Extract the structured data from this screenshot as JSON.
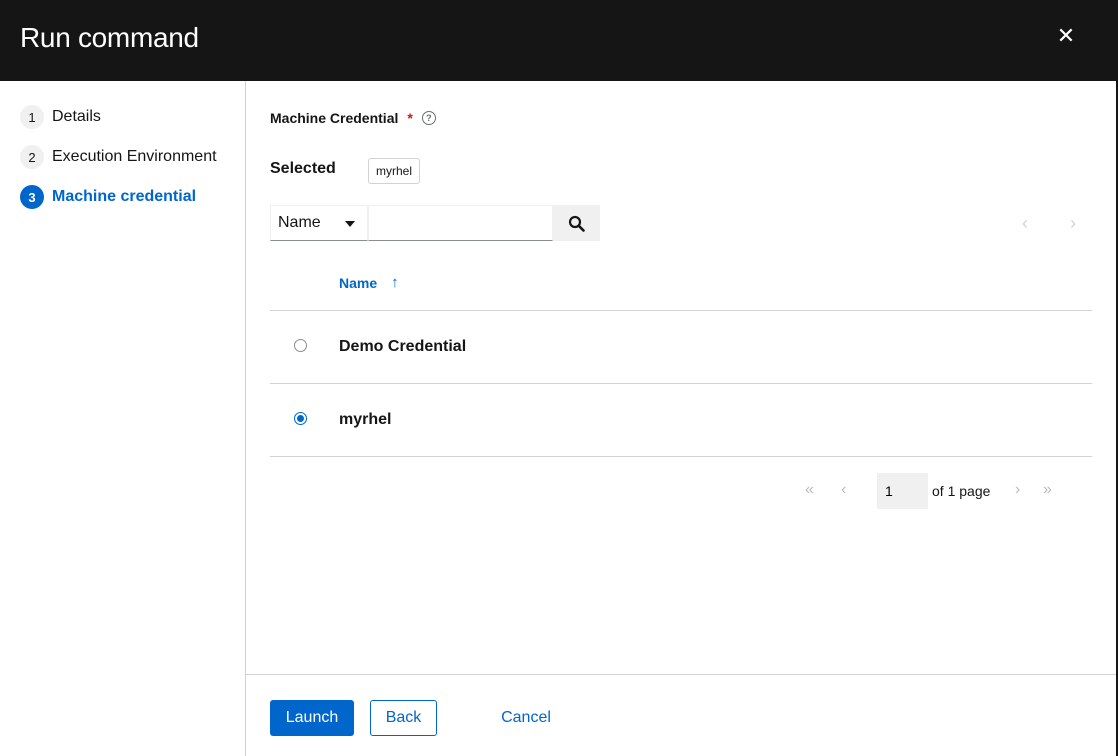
{
  "modal": {
    "title": "Run command",
    "close_icon": "close-icon"
  },
  "wizard": {
    "steps": [
      {
        "number": "1",
        "label": "Details",
        "active": false
      },
      {
        "number": "2",
        "label": "Execution Environment",
        "active": false
      },
      {
        "number": "3",
        "label": "Machine credential",
        "active": true
      }
    ]
  },
  "form": {
    "field_label": "Machine Credential",
    "required_marker": "*",
    "help_icon": "question-circle-icon",
    "selected_label": "Selected",
    "selected_chip": "myrhel"
  },
  "toolbar": {
    "filter_select_value": "Name",
    "search_value": "",
    "search_icon": "search-icon",
    "prev_icon": "chevron-left-icon",
    "next_icon": "chevron-right-icon"
  },
  "table": {
    "column_header": "Name",
    "sort_icon": "sort-ascending-icon",
    "rows": [
      {
        "name": "Demo Credential",
        "selected": false
      },
      {
        "name": "myrhel",
        "selected": true
      }
    ]
  },
  "pagination": {
    "current_page": "1",
    "of_pages_text": "of 1 page",
    "first_icon": "angle-double-left-icon",
    "prev_icon": "angle-left-icon",
    "next_icon": "angle-right-icon",
    "last_icon": "angle-double-right-icon"
  },
  "footer": {
    "launch_label": "Launch",
    "back_label": "Back",
    "cancel_label": "Cancel"
  },
  "colors": {
    "primary": "#0066cc",
    "header_bg": "#151515",
    "required": "#c9190b",
    "border": "#d2d2d2"
  }
}
